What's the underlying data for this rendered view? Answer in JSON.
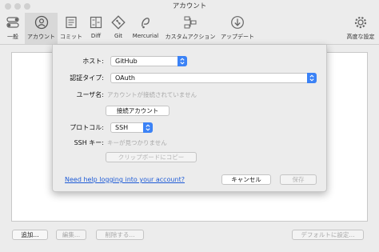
{
  "window": {
    "title": "アカウント"
  },
  "toolbar": {
    "items": [
      {
        "label": "一般",
        "icon": "switch-icon"
      },
      {
        "label": "アカウント",
        "icon": "account-icon",
        "active": true
      },
      {
        "label": "コミット",
        "icon": "commit-icon"
      },
      {
        "label": "Diff",
        "icon": "diff-icon"
      },
      {
        "label": "Git",
        "icon": "git-icon"
      },
      {
        "label": "Mercurial",
        "icon": "mercurial-icon"
      },
      {
        "label": "カスタムアクション",
        "icon": "custom-action-icon"
      },
      {
        "label": "アップデート",
        "icon": "update-icon"
      },
      {
        "label": "高度な設定",
        "icon": "gear-icon"
      }
    ]
  },
  "bottom": {
    "add_label": "追加...",
    "edit_label": "編集...",
    "delete_label": "削除する...",
    "default_label": "デフォルトに設定..."
  },
  "sheet": {
    "host_label": "ホスト:",
    "host_value": "GitHub",
    "auth_label": "認証タイプ:",
    "auth_value": "OAuth",
    "username_label": "ユーザ名:",
    "username_hint": "アカウントが接続されていません",
    "connect_button": "接続アカウント",
    "protocol_label": "プロトコル:",
    "protocol_value": "SSH",
    "sshkey_label": "SSH キー:",
    "sshkey_hint": "キーが見つかりません",
    "copy_button": "クリップボードにコピー",
    "help_link": "Need help logging into your account?",
    "cancel_button": "キャンセル",
    "save_button": "保存"
  },
  "colors": {
    "accent": "#3b82f6",
    "link": "#1e5bd6"
  }
}
